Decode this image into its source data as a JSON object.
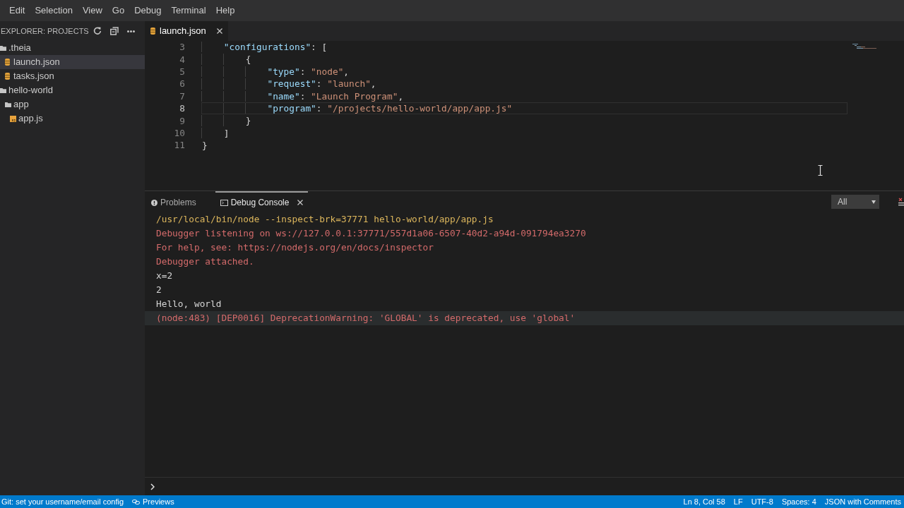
{
  "menu": [
    "Edit",
    "Selection",
    "View",
    "Go",
    "Debug",
    "Terminal",
    "Help"
  ],
  "explorer": {
    "title": "EXPLORER: PROJECTS",
    "tree": [
      {
        "label": ".theia",
        "kind": "folder",
        "selected": false,
        "children": [
          {
            "label": "launch.json",
            "kind": "json",
            "selected": true
          },
          {
            "label": "tasks.json",
            "kind": "json",
            "selected": false
          }
        ]
      },
      {
        "label": "hello-world",
        "kind": "folder",
        "selected": false,
        "children": [
          {
            "label": "app",
            "kind": "folder",
            "selected": false,
            "children": [
              {
                "label": "app.js",
                "kind": "js",
                "selected": false
              }
            ]
          }
        ]
      }
    ]
  },
  "editor": {
    "tabs": [
      {
        "label": "launch.json",
        "kind": "json",
        "selected": true
      }
    ],
    "lines": [
      {
        "number": "3",
        "current": false,
        "tokens": [
          {
            "kind": "key",
            "text": "    \"configurations\""
          },
          {
            "kind": "punct",
            "text": ": ["
          }
        ]
      },
      {
        "number": "4",
        "current": false,
        "tokens": [
          {
            "kind": "punct",
            "text": "        {"
          }
        ]
      },
      {
        "number": "5",
        "current": false,
        "tokens": [
          {
            "kind": "key",
            "text": "            \"type\""
          },
          {
            "kind": "punct",
            "text": ": "
          },
          {
            "kind": "string",
            "text": "\"node\""
          },
          {
            "kind": "punct",
            "text": ","
          }
        ]
      },
      {
        "number": "6",
        "current": false,
        "tokens": [
          {
            "kind": "key",
            "text": "            \"request\""
          },
          {
            "kind": "punct",
            "text": ": "
          },
          {
            "kind": "string",
            "text": "\"launch\""
          },
          {
            "kind": "punct",
            "text": ","
          }
        ]
      },
      {
        "number": "7",
        "current": false,
        "tokens": [
          {
            "kind": "key",
            "text": "            \"name\""
          },
          {
            "kind": "punct",
            "text": ": "
          },
          {
            "kind": "string",
            "text": "\"Launch Program\""
          },
          {
            "kind": "punct",
            "text": ","
          }
        ]
      },
      {
        "number": "8",
        "current": true,
        "tokens": [
          {
            "kind": "key",
            "text": "            \"program\""
          },
          {
            "kind": "punct",
            "text": ": "
          },
          {
            "kind": "string",
            "text": "\"/projects/hello-world/app/app.js\""
          }
        ]
      },
      {
        "number": "9",
        "current": false,
        "tokens": [
          {
            "kind": "punct",
            "text": "        }"
          }
        ]
      },
      {
        "number": "10",
        "current": false,
        "tokens": [
          {
            "kind": "punct",
            "text": "    ]"
          }
        ]
      },
      {
        "number": "11",
        "current": false,
        "tokens": [
          {
            "kind": "punct",
            "text": "}"
          }
        ]
      }
    ]
  },
  "panel": {
    "tabs": [
      {
        "label": "Problems",
        "kind": "problems",
        "selected": false
      },
      {
        "label": "Debug Console",
        "kind": "console",
        "selected": true
      }
    ],
    "filter": "All",
    "console": [
      {
        "kind": "command",
        "text": "/usr/local/bin/node --inspect-brk=37771 hello-world/app/app.js",
        "selected": false
      },
      {
        "kind": "error",
        "text": "Debugger listening on ws://127.0.0.1:37771/557d1a06-6507-40d2-a94d-091794ea3270",
        "selected": false
      },
      {
        "kind": "error",
        "text": "For help, see: https://nodejs.org/en/docs/inspector",
        "selected": false
      },
      {
        "kind": "error",
        "text": "Debugger attached.",
        "selected": false
      },
      {
        "kind": "output",
        "text": "x=2",
        "selected": false
      },
      {
        "kind": "output",
        "text": "2",
        "selected": false
      },
      {
        "kind": "output",
        "text": "Hello, world",
        "selected": false
      },
      {
        "kind": "error",
        "text": "(node:483) [DEP0016] DeprecationWarning: 'GLOBAL' is deprecated, use 'global'",
        "selected": true
      }
    ]
  },
  "status_bar": {
    "left": [
      {
        "kind": "plain",
        "text": "Git: set your username/email config"
      },
      {
        "kind": "preview",
        "text": "Previews"
      }
    ],
    "right": [
      "Ln 8, Col 58",
      "LF",
      "UTF-8",
      "Spaces: 4",
      "JSON with Comments"
    ]
  }
}
